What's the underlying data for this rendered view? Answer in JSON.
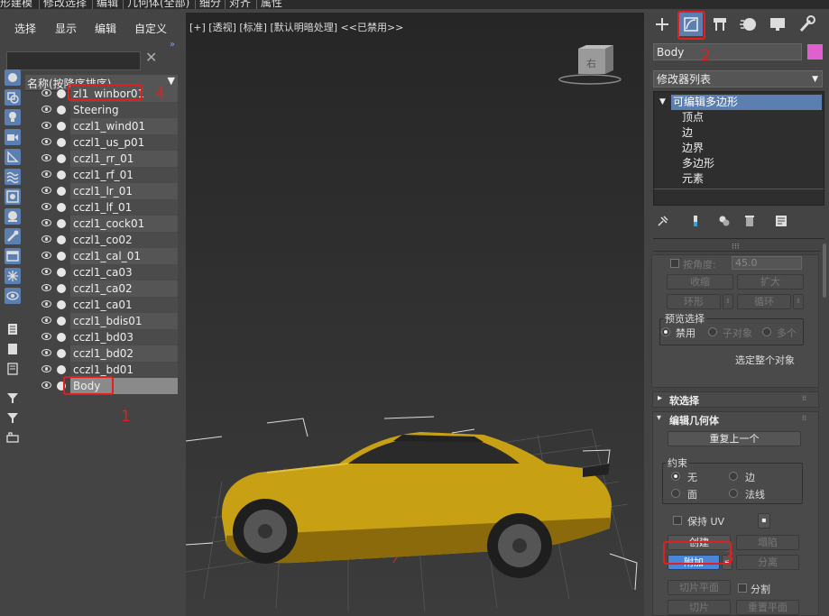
{
  "top_menu": [
    "形建模",
    "修改选择",
    "编辑",
    "几何体(全部)",
    "细分",
    "对齐",
    "属性"
  ],
  "scene_explorer": {
    "tabs": [
      "选择",
      "显示",
      "编辑",
      "自定义"
    ],
    "search_value": "",
    "column_header": "名称(按降序排序)",
    "objects": [
      "zl1_winbor01",
      "Steering",
      "cczl1_wind01",
      "cczl1_us_p01",
      "cczl1_rr_01",
      "cczl1_rf_01",
      "cczl1_lr_01",
      "cczl1_lf_01",
      "cczl1_cock01",
      "cczl1_co02",
      "cczl1_cal_01",
      "cczl1_ca03",
      "cczl1_ca02",
      "cczl1_ca01",
      "cczl1_bdis01",
      "cczl1_bd03",
      "cczl1_bd02",
      "cczl1_bd01",
      "Body"
    ],
    "selected": "Body"
  },
  "viewport": {
    "label": "[+] [透视] [标准] [默认明暗处理] <<已禁用>>",
    "viewcube_face": "右"
  },
  "command_panel": {
    "object_name": "Body",
    "object_color": "#e060d0",
    "modifier_list_label": "修改器列表",
    "stack": {
      "root": "可编辑多边形",
      "sub": [
        "顶点",
        "边",
        "边界",
        "多边形",
        "元素"
      ]
    },
    "selection_rollout": {
      "by_angle_label": "按角度:",
      "angle_value": "45.0",
      "shrink": "收缩",
      "grow": "扩大",
      "ring": "环形",
      "loop": "循环",
      "preview_selection_label": "预览选择",
      "preview_options": [
        "禁用",
        "子对象",
        "多个"
      ],
      "select_whole_object": "选定整个对象"
    },
    "soft_selection_title": "软选择",
    "edit_geometry": {
      "title": "编辑几何体",
      "repeat_last": "重复上一个",
      "constraints_label": "约束",
      "constraints": [
        "无",
        "边",
        "面",
        "法线"
      ],
      "preserve_uv": "保持 UV",
      "create": "创建",
      "collapse": "塌陷",
      "attach": "附加",
      "detach": "分离",
      "slice_plane": "切片平面",
      "split": "分割",
      "slice": "切片",
      "reset_plane": "重置平面"
    }
  },
  "annotations": [
    "1",
    "2",
    "3",
    "4"
  ],
  "colors": {
    "highlight": "#5a7fb0",
    "annotation": "#e02020",
    "car_body": "#c8a014"
  }
}
